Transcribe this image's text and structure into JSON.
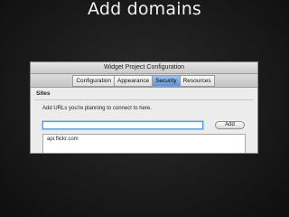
{
  "slide": {
    "title": "Add domains"
  },
  "window": {
    "title": "Widget Project Configuration"
  },
  "tabs": [
    {
      "label": "Configuration"
    },
    {
      "label": "Appearance"
    },
    {
      "label": "Security",
      "active": true
    },
    {
      "label": "Resources"
    }
  ],
  "sites": {
    "header": "Sites",
    "hint": "Add URLs you're planning to connect to here.",
    "input_value": "",
    "add_label": "Add",
    "items": [
      "api.flickr.com"
    ]
  },
  "colors": {
    "active_tab": "#5f95d6",
    "focus_ring": "#5a9ae8",
    "background": "#1a1a1a"
  }
}
